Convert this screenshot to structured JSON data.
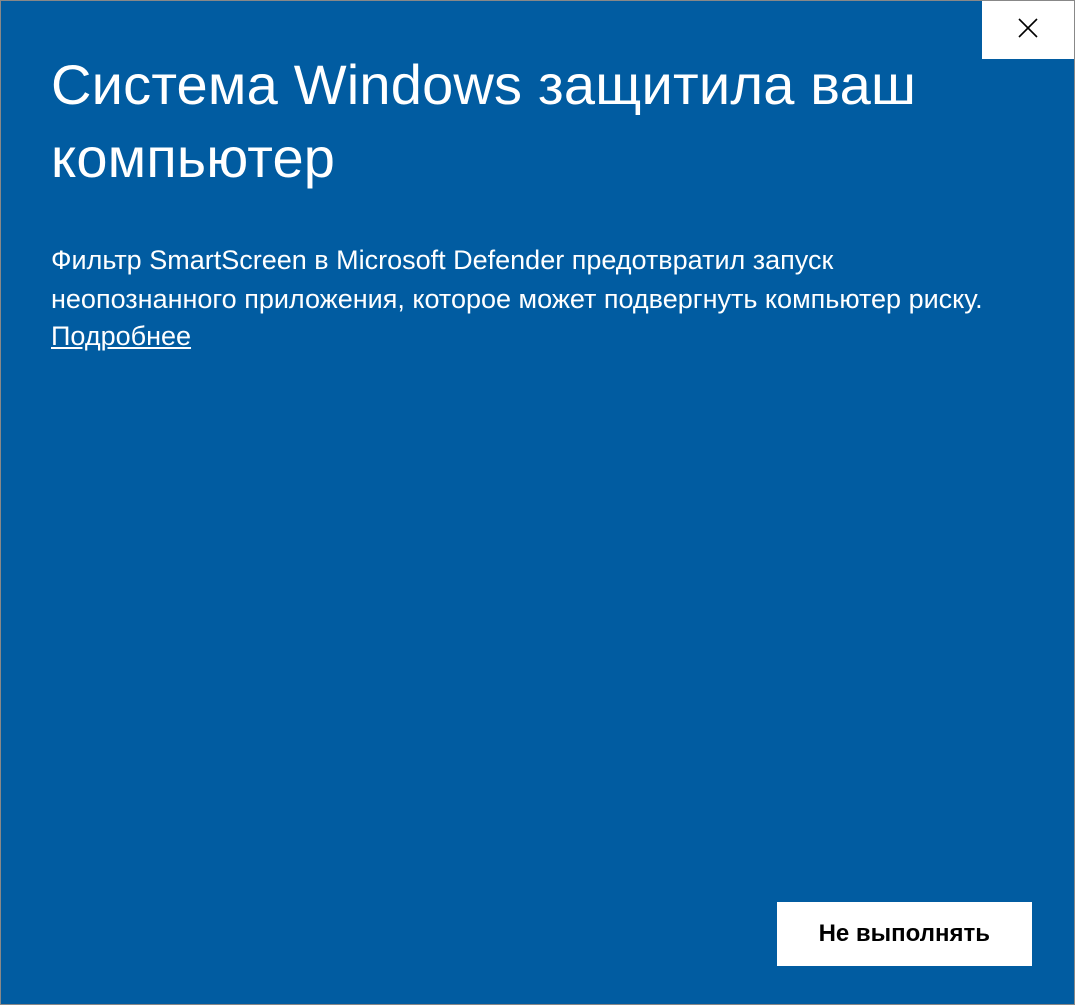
{
  "dialog": {
    "title": "Система Windows защитила ваш компьютер",
    "body": "Фильтр SmartScreen в Microsoft Defender предотвратил запуск неопознанного приложения, которое может подвергнуть компьютер риску.",
    "more_link": "Подробнее",
    "dont_run_label": "Не выполнять"
  }
}
